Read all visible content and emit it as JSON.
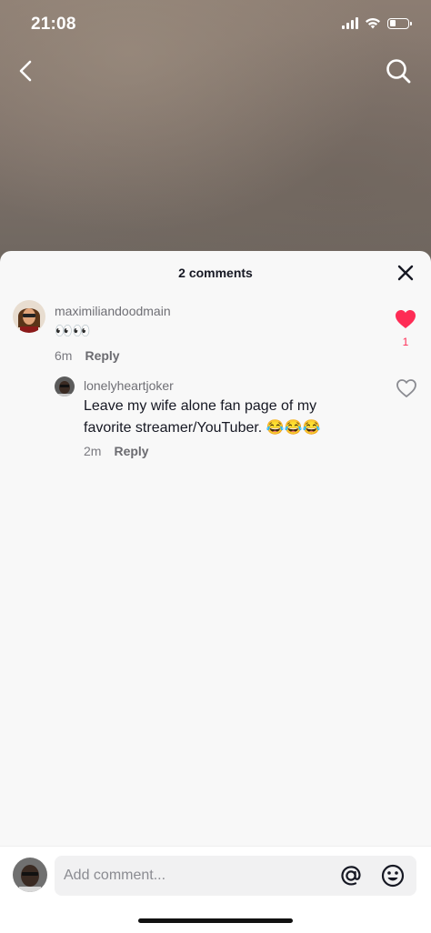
{
  "status_bar": {
    "time": "21:08",
    "battery_level": 0.3
  },
  "nav": {
    "back_icon": "chevron-left-icon",
    "search_icon": "search-icon"
  },
  "comments_sheet": {
    "title": "2 comments",
    "close_icon": "close-icon",
    "comments": [
      {
        "username": "maximiliandoodmain",
        "text": "👀👀",
        "time": "6m",
        "reply_label": "Reply",
        "like_count": "1",
        "liked": true
      },
      {
        "username": "lonelyheartjoker",
        "text": "Leave my wife alone fan page of my favorite streamer/YouTuber. 😂😂😂",
        "time": "2m",
        "reply_label": "Reply",
        "liked": false
      }
    ]
  },
  "composer": {
    "placeholder": "Add comment...",
    "mention_icon": "at-icon",
    "emoji_icon": "emoji-icon"
  },
  "colors": {
    "like": "#fe2c55",
    "sheet_bg": "#f8f8f8",
    "text": "#161823"
  }
}
